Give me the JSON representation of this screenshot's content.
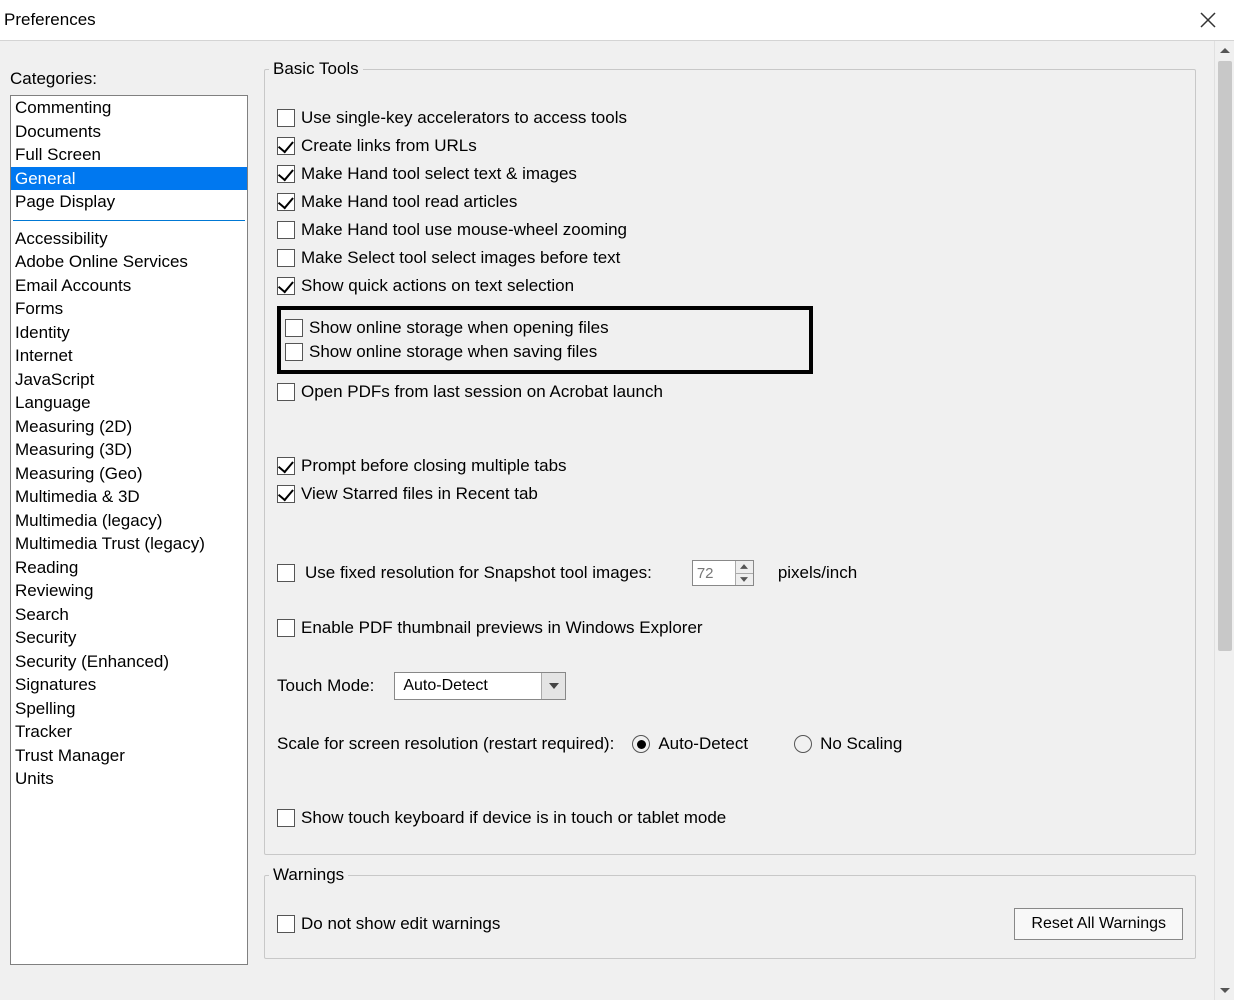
{
  "window": {
    "title": "Preferences"
  },
  "sidebar": {
    "label": "Categories:",
    "group1": [
      "Commenting",
      "Documents",
      "Full Screen",
      "General",
      "Page Display"
    ],
    "group2": [
      "Accessibility",
      "Adobe Online Services",
      "Email Accounts",
      "Forms",
      "Identity",
      "Internet",
      "JavaScript",
      "Language",
      "Measuring (2D)",
      "Measuring (3D)",
      "Measuring (Geo)",
      "Multimedia & 3D",
      "Multimedia (legacy)",
      "Multimedia Trust (legacy)",
      "Reading",
      "Reviewing",
      "Search",
      "Security",
      "Security (Enhanced)",
      "Signatures",
      "Spelling",
      "Tracker",
      "Trust Manager",
      "Units"
    ],
    "selected": "General"
  },
  "basic": {
    "legend": "Basic Tools",
    "use_single_key": "Use single-key accelerators to access tools",
    "create_links": "Create links from URLs",
    "hand_text_images": "Make Hand tool select text & images",
    "hand_articles": "Make Hand tool read articles",
    "hand_zoom": "Make Hand tool use mouse-wheel zooming",
    "select_images_first": "Make Select tool select images before text",
    "quick_actions": "Show quick actions on text selection",
    "online_open": "Show online storage when opening files",
    "online_save": "Show online storage when saving files",
    "open_last": "Open PDFs from last session on Acrobat launch",
    "prompt_tabs": "Prompt before closing multiple tabs",
    "starred_recent": "View Starred files in Recent tab",
    "fixed_res": "Use fixed resolution for Snapshot tool images:",
    "fixed_res_value": "72",
    "pixels_inch": "pixels/inch",
    "thumb_previews": "Enable PDF thumbnail previews in Windows Explorer",
    "touch_mode_label": "Touch Mode:",
    "touch_mode_value": "Auto-Detect",
    "scale_label": "Scale for screen resolution (restart required):",
    "scale_auto": "Auto-Detect",
    "scale_none": "No Scaling",
    "touch_keyboard": "Show touch keyboard if device is in touch or tablet mode"
  },
  "warnings": {
    "legend": "Warnings",
    "no_edit": "Do not show edit warnings",
    "reset": "Reset All Warnings"
  }
}
